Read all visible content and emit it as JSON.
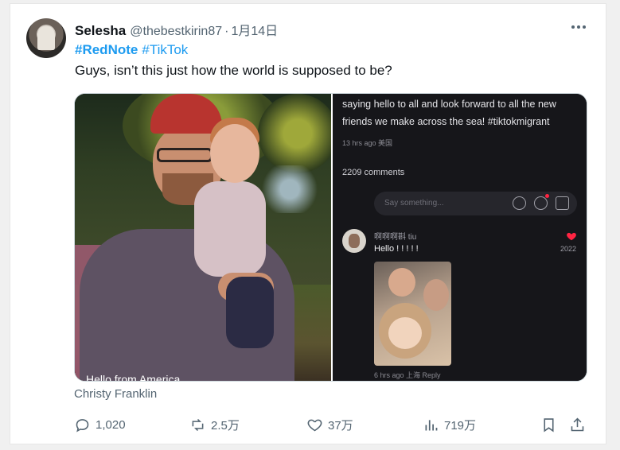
{
  "tweet": {
    "author_name": "Selesha",
    "handle": "@thebestkirin87",
    "separator": "·",
    "date": "1月14日",
    "hashtags": [
      "#RedNote",
      "#TikTok"
    ],
    "text": "Guys, isn’t this just how the world is supposed to be?"
  },
  "media": {
    "photo_caption": "Hello from America",
    "attribution": "Christy Franklin",
    "screenshot": {
      "description": "saying hello to all and look forward to all the new friends we make across the sea!  #tiktokmigrant",
      "meta": "13 hrs ago 美国",
      "comments_count": "2209 comments",
      "comment_placeholder": "Say something...",
      "comment": {
        "user": "啊啊啊斟 tiu",
        "text": "Hello ! ! ! ! !",
        "likes": "2022",
        "meta": "6 hrs ago 上海 Reply"
      }
    }
  },
  "actions": {
    "replies": "1,020",
    "reposts": "2.5万",
    "likes": "37万",
    "views": "719万"
  },
  "colors": {
    "link": "#1d9bf0",
    "secondary_text": "#536471",
    "heart_red": "#ff2442"
  },
  "icons": {
    "more": "more-horizontal-icon",
    "reply": "reply-icon",
    "repost": "repost-icon",
    "like": "heart-icon",
    "views": "bar-chart-icon",
    "bookmark": "bookmark-icon",
    "share": "share-icon"
  }
}
